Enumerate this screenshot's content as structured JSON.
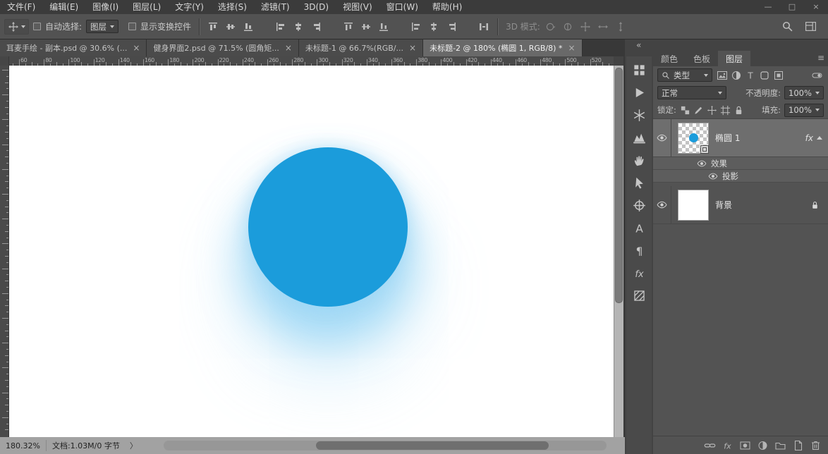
{
  "menu": {
    "items": [
      "文件(F)",
      "编辑(E)",
      "图像(I)",
      "图层(L)",
      "文字(Y)",
      "选择(S)",
      "滤镜(T)",
      "3D(D)",
      "视图(V)",
      "窗口(W)",
      "帮助(H)"
    ]
  },
  "window_controls": [
    {
      "name": "minimize",
      "glyph": "—"
    },
    {
      "name": "maximize",
      "glyph": "□"
    },
    {
      "name": "close",
      "glyph": "×"
    }
  ],
  "options_bar": {
    "tool_icon": "move-tool",
    "auto_select_label": "自动选择:",
    "auto_select_value": "图层",
    "show_transform_label": "显示变换控件",
    "align_icons": [
      "align-top-edges",
      "align-vertical-centers",
      "align-bottom-edges",
      "align-left-edges",
      "align-horizontal-centers",
      "align-right-edges",
      "distribute-top-edges",
      "distribute-vertical-centers",
      "distribute-bottom-edges",
      "distribute-left-edges",
      "distribute-horizontal-centers",
      "distribute-right-edges",
      "distribute-spacing"
    ],
    "mode_3d_label": "3D 模式:",
    "mode_3d_icons": [
      "orbit-3d",
      "roll-3d",
      "pan-3d",
      "slide-3d",
      "scale-3d"
    ],
    "right_icons": [
      "search",
      "workspace-switcher"
    ]
  },
  "tabs": [
    {
      "label": "耳麦手绘 - 副本.psd @ 30.6% (...",
      "close": "×",
      "active": false
    },
    {
      "label": "健身界面2.psd @ 71.5% (圆角矩...",
      "close": "×",
      "active": false
    },
    {
      "label": "未标题-1 @ 66.7%(RGB/...",
      "close": "×",
      "active": false
    },
    {
      "label": "未标题-2 @ 180% (椭圆 1, RGB/8) *",
      "close": "×",
      "active": true
    }
  ],
  "ruler": {
    "top_labels": [
      "60",
      "80",
      "100",
      "120",
      "140",
      "160",
      "180",
      "200",
      "220",
      "240",
      "260",
      "280",
      "300",
      "320",
      "340",
      "360",
      "380",
      "400",
      "420",
      "440",
      "460",
      "480",
      "500",
      "520"
    ]
  },
  "canvas": {
    "shape_color": "#1b9cdb"
  },
  "sidebar": {
    "collapse_glyph": "«",
    "panel_menu_glyph": "≡",
    "tool_icons": [
      "collections-grid",
      "actions-play",
      "snowflake-3d",
      "histogram",
      "hand-tool-panel",
      "selection-pointer",
      "clone-source",
      "character-panel",
      "paragraph-panel",
      "styles-panel",
      "patterns-panel"
    ],
    "panel_tabs": [
      {
        "label": "颜色",
        "active": false
      },
      {
        "label": "色板",
        "active": false
      },
      {
        "label": "图层",
        "active": true
      }
    ],
    "layers_panel": {
      "filter_label": "类型",
      "filter_icons": [
        "pixel-layer-filter",
        "adjustment-layer-filter",
        "type-layer-filter",
        "shape-layer-filter",
        "smart-object-filter"
      ],
      "blend_mode": "正常",
      "opacity_label": "不透明度:",
      "opacity_value": "100%",
      "lock_label": "锁定:",
      "lock_icons": [
        "lock-transparent-pixels",
        "lock-image-pixels",
        "lock-position",
        "lock-artboard",
        "lock-all"
      ],
      "fill_label": "填充:",
      "fill_value": "100%",
      "layer1": {
        "name": "椭圆 1",
        "fx_label": "fx"
      },
      "effects_label": "效果",
      "shadow_label": "投影",
      "layer2": {
        "name": "背景"
      },
      "bottom_icons": [
        "link-layers",
        "layer-style-fx",
        "add-layer-mask",
        "new-adjustment-layer",
        "new-group",
        "new-layer",
        "delete-layer"
      ]
    }
  },
  "status_bar": {
    "zoom": "180.32%",
    "doc_info": "文档:1.03M/0 字节",
    "flyout": "〉"
  }
}
